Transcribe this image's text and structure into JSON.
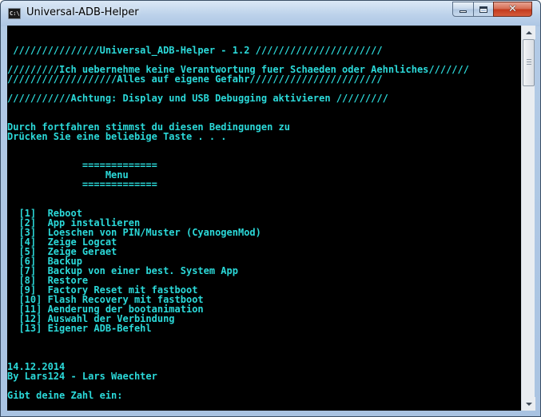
{
  "window": {
    "title": "Universal-ADB-Helper",
    "icon": "cmd-icon",
    "icon_glyph": "C:\\",
    "controls": {
      "minimize_icon": "minimize-icon",
      "maximize_icon": "maximize-icon",
      "close_icon": "close-icon",
      "close_glyph": "✕"
    }
  },
  "console": {
    "text_color": "#2bd9d9",
    "background": "#000000",
    "header": {
      "banner": " ///////////////Universal_ADB-Helper - 1.2 //////////////////////",
      "disclaimer_1": "/////////Ich uebernehme keine Verantwortung fuer Schaeden oder Aehnliches///////",
      "disclaimer_2": "///////////////////Alles auf eigene Gefahr///////////////////////",
      "warning": "///////////Achtung: Display und USB Debugging aktivieren /////////",
      "agree_1": "Durch fortfahren stimmst du diesen Bedingungen zu",
      "agree_2": "Drücken Sie eine beliebige Taste . . ."
    },
    "menu": {
      "rule_top": "             =============",
      "title": "                 Menu",
      "rule_bottom": "             =============",
      "items": [
        "  [1]  Reboot",
        "  [2]  App installieren",
        "  [3]  Loeschen von PIN/Muster (CyanogenMod)",
        "  [4]  Zeige Logcat",
        "  [5]  Zeige Geraet",
        "  [6]  Backup",
        "  [7]  Backup von einer best. System App",
        "  [8]  Restore",
        "  [9]  Factory Reset mit fastboot",
        "  [10] Flash Recovery mit fastboot",
        "  [11] Aenderung der bootanimation",
        "  [12] Auswahl der Verbindung",
        "  [13] Eigener ADB-Befehl"
      ]
    },
    "footer": {
      "date": "14.12.2014",
      "author": "By Lars124 - Lars Waechter",
      "prompt": "Gibt deine Zahl ein:"
    }
  },
  "scrollbar": {
    "up_icon": "scroll-up-arrow-icon",
    "down_icon": "scroll-down-arrow-icon"
  }
}
